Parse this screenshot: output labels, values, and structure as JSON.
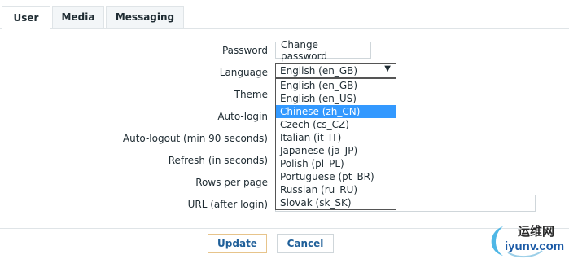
{
  "tabs": [
    {
      "label": "User",
      "active": true
    },
    {
      "label": "Media",
      "active": false
    },
    {
      "label": "Messaging",
      "active": false
    }
  ],
  "form": {
    "password_label": "Password",
    "change_password_label": "Change password",
    "language_label": "Language",
    "language_selected": "English (en_GB)",
    "theme_label": "Theme",
    "autologin_label": "Auto-login",
    "autologout_label": "Auto-logout (min 90 seconds)",
    "refresh_label": "Refresh (in seconds)",
    "rows_label": "Rows per page",
    "url_label": "URL (after login)",
    "url_value": ""
  },
  "language_options": [
    "English (en_GB)",
    "English (en_US)",
    "Chinese (zh_CN)",
    "Czech (cs_CZ)",
    "Italian (it_IT)",
    "Japanese (ja_JP)",
    "Polish (pl_PL)",
    "Portuguese (pt_BR)",
    "Russian (ru_RU)",
    "Slovak (sk_SK)"
  ],
  "highlighted_option": "Chinese (zh_CN)",
  "buttons": {
    "update": "Update",
    "cancel": "Cancel"
  },
  "watermark": {
    "line1": "运维网",
    "line2": "iyunv.com"
  },
  "colors": {
    "highlight": "#3399ff",
    "link_blue": "#1f5f99",
    "tab_bg": "#f3f6f8"
  }
}
